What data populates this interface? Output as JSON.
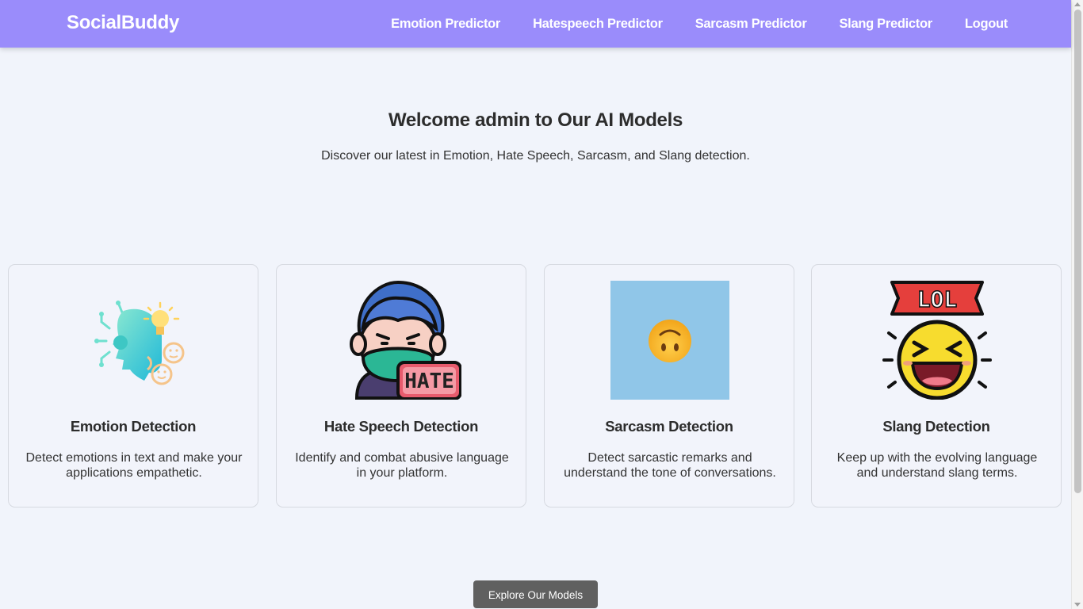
{
  "navbar": {
    "brand": "SocialBuddy",
    "links": [
      "Emotion Predictor",
      "Hatespeech Predictor",
      "Sarcasm Predictor",
      "Slang Predictor",
      "Logout"
    ]
  },
  "hero": {
    "title": "Welcome admin to Our AI Models",
    "subtitle": "Discover our latest in Emotion, Hate Speech, Sarcasm, and Slang detection."
  },
  "cards": [
    {
      "title": "Emotion Detection",
      "description": "Detect emotions in text and make your applications empathetic.",
      "icon": "emotion-head-icon"
    },
    {
      "title": "Hate Speech Detection",
      "description": "Identify and combat abusive language in your platform.",
      "icon": "hate-speech-icon"
    },
    {
      "title": "Sarcasm Detection",
      "description": "Detect sarcastic remarks and understand the tone of conversations.",
      "icon": "upside-down-face-icon"
    },
    {
      "title": "Slang Detection",
      "description": "Keep up with the evolving language and understand slang terms.",
      "icon": "lol-laughing-face-icon",
      "badge_text": "LOL"
    }
  ],
  "hate_badge_text": "HATE",
  "cta": {
    "label": "Explore Our Models"
  },
  "colors": {
    "navbar": "#9a8cfb",
    "page_background": "#f1f4fb",
    "button": "#606060",
    "sarcasm_tile": "#90c6e8"
  }
}
